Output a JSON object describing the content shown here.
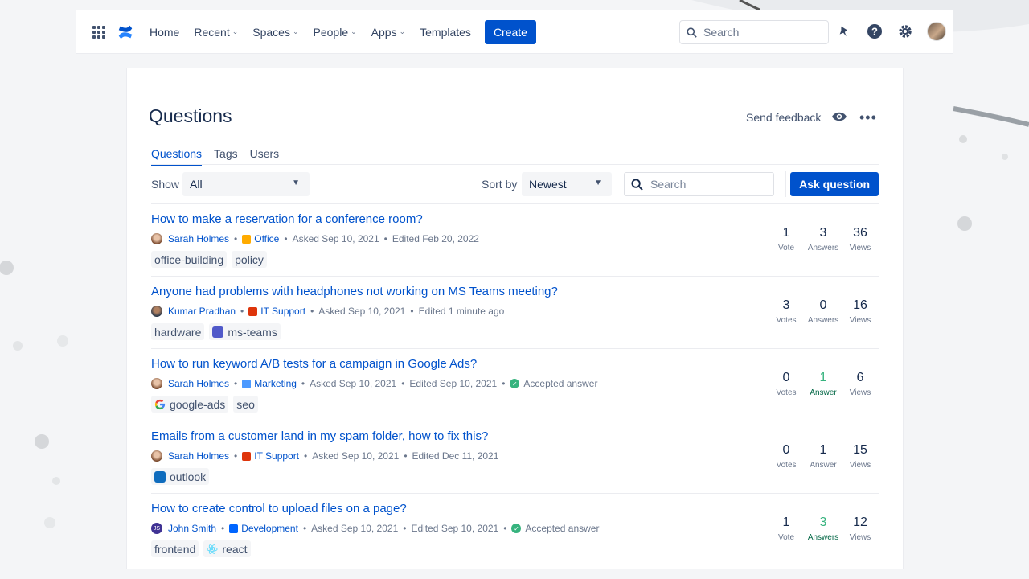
{
  "topnav": {
    "items": [
      {
        "label": "Home",
        "dropdown": false
      },
      {
        "label": "Recent",
        "dropdown": true
      },
      {
        "label": "Spaces",
        "dropdown": true
      },
      {
        "label": "People",
        "dropdown": true
      },
      {
        "label": "Apps",
        "dropdown": true
      },
      {
        "label": "Templates",
        "dropdown": false
      }
    ],
    "create_label": "Create",
    "search_placeholder": "Search",
    "icons": [
      "app-switcher-icon",
      "confluence-logo-icon",
      "notifications-icon",
      "help-icon",
      "settings-icon",
      "profile-avatar"
    ]
  },
  "page": {
    "title": "Questions",
    "send_feedback": "Send feedback",
    "tabs": [
      "Questions",
      "Tags",
      "Users"
    ],
    "active_tab": "Questions"
  },
  "filters": {
    "show_label": "Show",
    "show_value": "All",
    "sort_label": "Sort by",
    "sort_value": "Newest",
    "search_placeholder": "Search",
    "ask_label": "Ask question"
  },
  "questions": [
    {
      "title": "How to make a reservation for a conference room?",
      "author": "Sarah Holmes",
      "space": "Office",
      "asked": "Asked Sep 10, 2021",
      "edited": "Edited Feb 20, 2022",
      "accepted": "",
      "tags": [
        "office-building",
        "policy"
      ],
      "votes": "1",
      "votes_label": "Vote",
      "answers": "3",
      "answers_label": "Answers",
      "views": "36",
      "views_label": "Views"
    },
    {
      "title": "Anyone had problems with headphones not working on MS Teams meeting?",
      "author": "Kumar Pradhan",
      "space": "IT Support",
      "asked": "Asked Sep 10, 2021",
      "edited": "Edited 1 minute ago",
      "accepted": "",
      "tags": [
        "hardware",
        "ms-teams"
      ],
      "votes": "3",
      "votes_label": "Votes",
      "answers": "0",
      "answers_label": "Answers",
      "views": "16",
      "views_label": "Views"
    },
    {
      "title": "How to run keyword A/B tests for a campaign in Google Ads?",
      "author": "Sarah Holmes",
      "space": "Marketing",
      "asked": "Asked Sep 10, 2021",
      "edited": "Edited Sep 10, 2021",
      "accepted": "Accepted answer",
      "tags": [
        "google-ads",
        "seo"
      ],
      "votes": "0",
      "votes_label": "Votes",
      "answers": "1",
      "answers_label": "Answer",
      "views": "6",
      "views_label": "Views"
    },
    {
      "title": "Emails from a customer land in my spam folder, how to fix this?",
      "author": "Sarah Holmes",
      "space": "IT Support",
      "asked": "Asked Sep 10, 2021",
      "edited": "Edited Dec 11, 2021",
      "accepted": "",
      "tags": [
        "outlook"
      ],
      "votes": "0",
      "votes_label": "Votes",
      "answers": "1",
      "answers_label": "Answer",
      "views": "15",
      "views_label": "Views"
    },
    {
      "title": "How to create control to upload files on a page?",
      "author": "John Smith",
      "space": "Development",
      "asked": "Asked Sep 10, 2021",
      "edited": "Edited Sep 10, 2021",
      "accepted": "Accepted answer",
      "tags": [
        "frontend",
        "react"
      ],
      "votes": "1",
      "votes_label": "Vote",
      "answers": "3",
      "answers_label": "Answers",
      "views": "12",
      "views_label": "Views"
    }
  ],
  "colors": {
    "primary": "#0052cc",
    "accepted_green": "#36b37e",
    "text": "#172b4d"
  }
}
